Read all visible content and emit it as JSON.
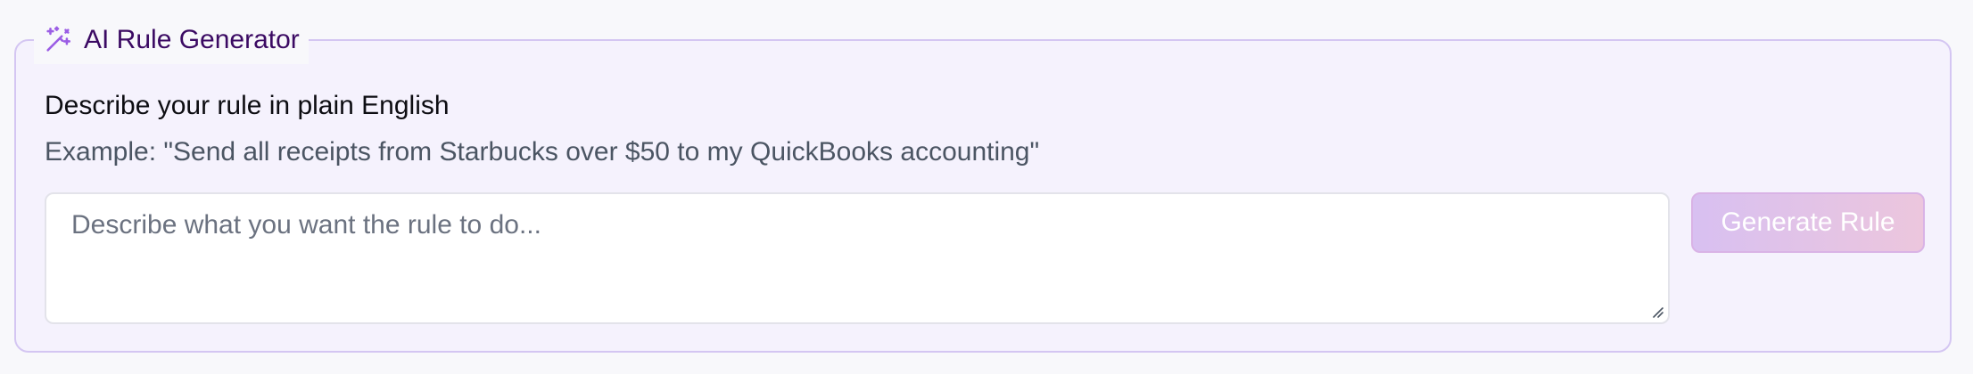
{
  "panel": {
    "title": "AI Rule Generator",
    "icon": "magic-wand-sparkles-icon",
    "accent_color": "#9b5de5",
    "border_color": "#d4c6f2",
    "background_color": "#f5f2fd"
  },
  "form": {
    "heading": "Describe your rule in plain English",
    "example": "Example: \"Send all receipts from Starbucks over $50 to my QuickBooks accounting\"",
    "input": {
      "value": "",
      "placeholder": "Describe what you want the rule to do..."
    },
    "submit": {
      "label": "Generate Rule",
      "disabled": true
    }
  }
}
